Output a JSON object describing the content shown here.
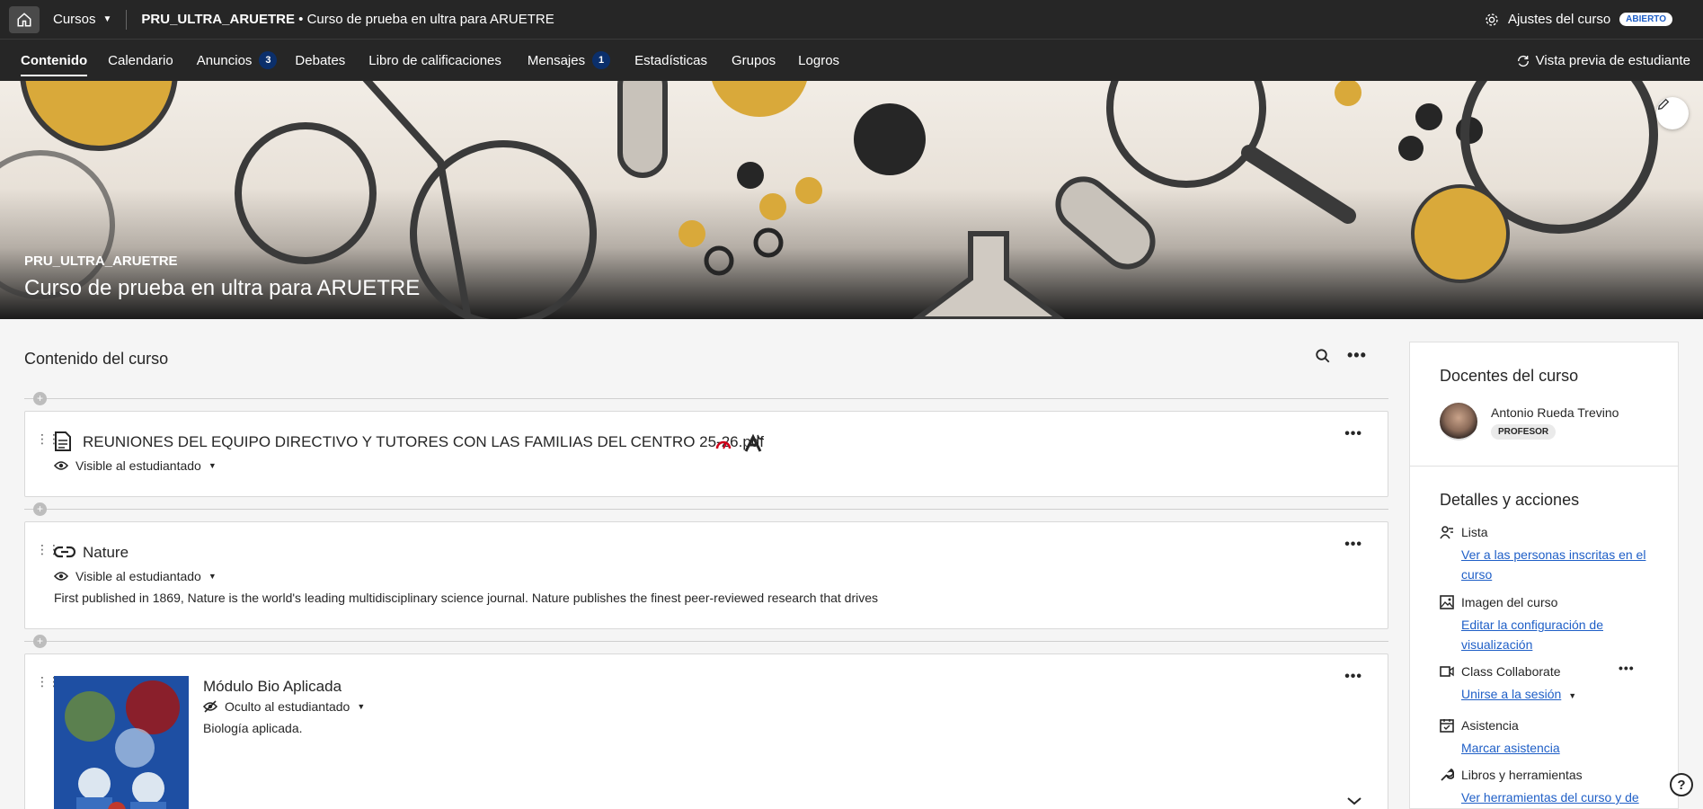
{
  "topbar": {
    "cursos_label": "Cursos",
    "course_code": "PRU_ULTRA_ARUETRE",
    "separator": " • ",
    "course_name": "Curso de prueba en ultra para ARUETRE",
    "settings_label": "Ajustes del curso",
    "status_badge": "ABIERTO"
  },
  "nav": {
    "items": [
      {
        "label": "Contenido"
      },
      {
        "label": "Calendario"
      },
      {
        "label": "Anuncios",
        "count": "3"
      },
      {
        "label": "Debates"
      },
      {
        "label": "Libro de calificaciones"
      },
      {
        "label": "Mensajes",
        "count": "1"
      },
      {
        "label": "Estadísticas"
      },
      {
        "label": "Grupos"
      },
      {
        "label": "Logros"
      }
    ],
    "preview_label": "Vista previa de estudiante"
  },
  "banner": {
    "code": "PRU_ULTRA_ARUETRE",
    "title": "Curso de prueba en ultra para ARUETRE"
  },
  "content": {
    "title": "Contenido del curso",
    "items": [
      {
        "title": "REUNIONES DEL EQUIPO DIRECTIVO Y TUTORES CON LAS FAMILIAS DEL CENTRO 25-26.pdf",
        "visibility": "Visible al estudiantado"
      },
      {
        "title": "Nature",
        "visibility": "Visible al estudiantado",
        "description": "First published in 1869, Nature is the world's leading multidisciplinary science journal. Nature publishes the finest peer-reviewed research that drives"
      },
      {
        "title": "Módulo Bio Aplicada",
        "visibility": "Oculto al estudiantado",
        "description": "Biología aplicada."
      }
    ]
  },
  "sidebar": {
    "teachers_title": "Docentes del curso",
    "teacher_name": "Antonio Rueda Trevino",
    "teacher_role": "PROFESOR",
    "details_title": "Detalles y acciones",
    "details": [
      {
        "label": "Lista",
        "link": "Ver a las personas inscritas en el curso"
      },
      {
        "label": "Imagen del curso",
        "link": "Editar la configuración de visualización"
      },
      {
        "label": "Class Collaborate",
        "link": "Unirse a la sesión"
      },
      {
        "label": "Asistencia",
        "link": "Marcar asistencia"
      },
      {
        "label": "Libros y herramientas",
        "link": "Ver herramientas del curso y de"
      }
    ]
  },
  "colors": {
    "topbar": "#262626",
    "link": "#1f5fc7",
    "badge_count": "#0b2f6b"
  }
}
